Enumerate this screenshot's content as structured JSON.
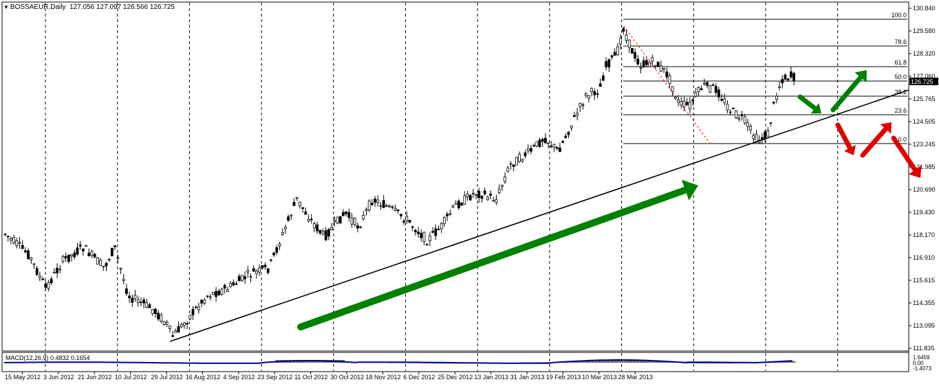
{
  "header": {
    "dropdown_icon": "triangle-down-icon",
    "symbol": "BOSSAEUR,Daily",
    "ohlc": "127.056 127.097 126.566 126.725"
  },
  "price_axis": {
    "ticks": [
      "130.840",
      "129.580",
      "128.320",
      "127.060",
      "125.765",
      "124.505",
      "123.245",
      "121.985",
      "120.690",
      "119.430",
      "118.170",
      "116.910",
      "115.615",
      "114.355",
      "113.095",
      "111.835"
    ],
    "current_price": "126.725"
  },
  "time_axis": {
    "labels": [
      "15 May 2012",
      "3 Jun 2012",
      "21 Jun 2012",
      "10 Jul 2012",
      "29 Jul 2012",
      "16 Aug 2012",
      "4 Sep 2012",
      "23 Sep 2012",
      "11 Oct 2012",
      "30 Oct 2012",
      "18 Nov 2012",
      "6 Dec 2012",
      "25 Dec 2012",
      "13 Jan 2013",
      "31 Jan 2013",
      "19 Feb 2013",
      "10 Mar 2013",
      "28 Mar 2013"
    ]
  },
  "fibonacci": {
    "levels": [
      "100.0",
      "78.6",
      "61.8",
      "50.0",
      "38.2",
      "23.6",
      "0.0"
    ]
  },
  "macd": {
    "label": "MACD(12,26,9) 0.4832 0.1654",
    "ticks": [
      "1.6459",
      "0.00",
      "-1.4073"
    ]
  },
  "colors": {
    "background": "#ffffff",
    "grid": "#000000",
    "candle": "#000000",
    "trendline": "#000000",
    "bull_arrow": "#008000",
    "bear_arrow": "#e00000",
    "macd_signal": "#00008b",
    "current_price_bg": "#000000"
  }
}
